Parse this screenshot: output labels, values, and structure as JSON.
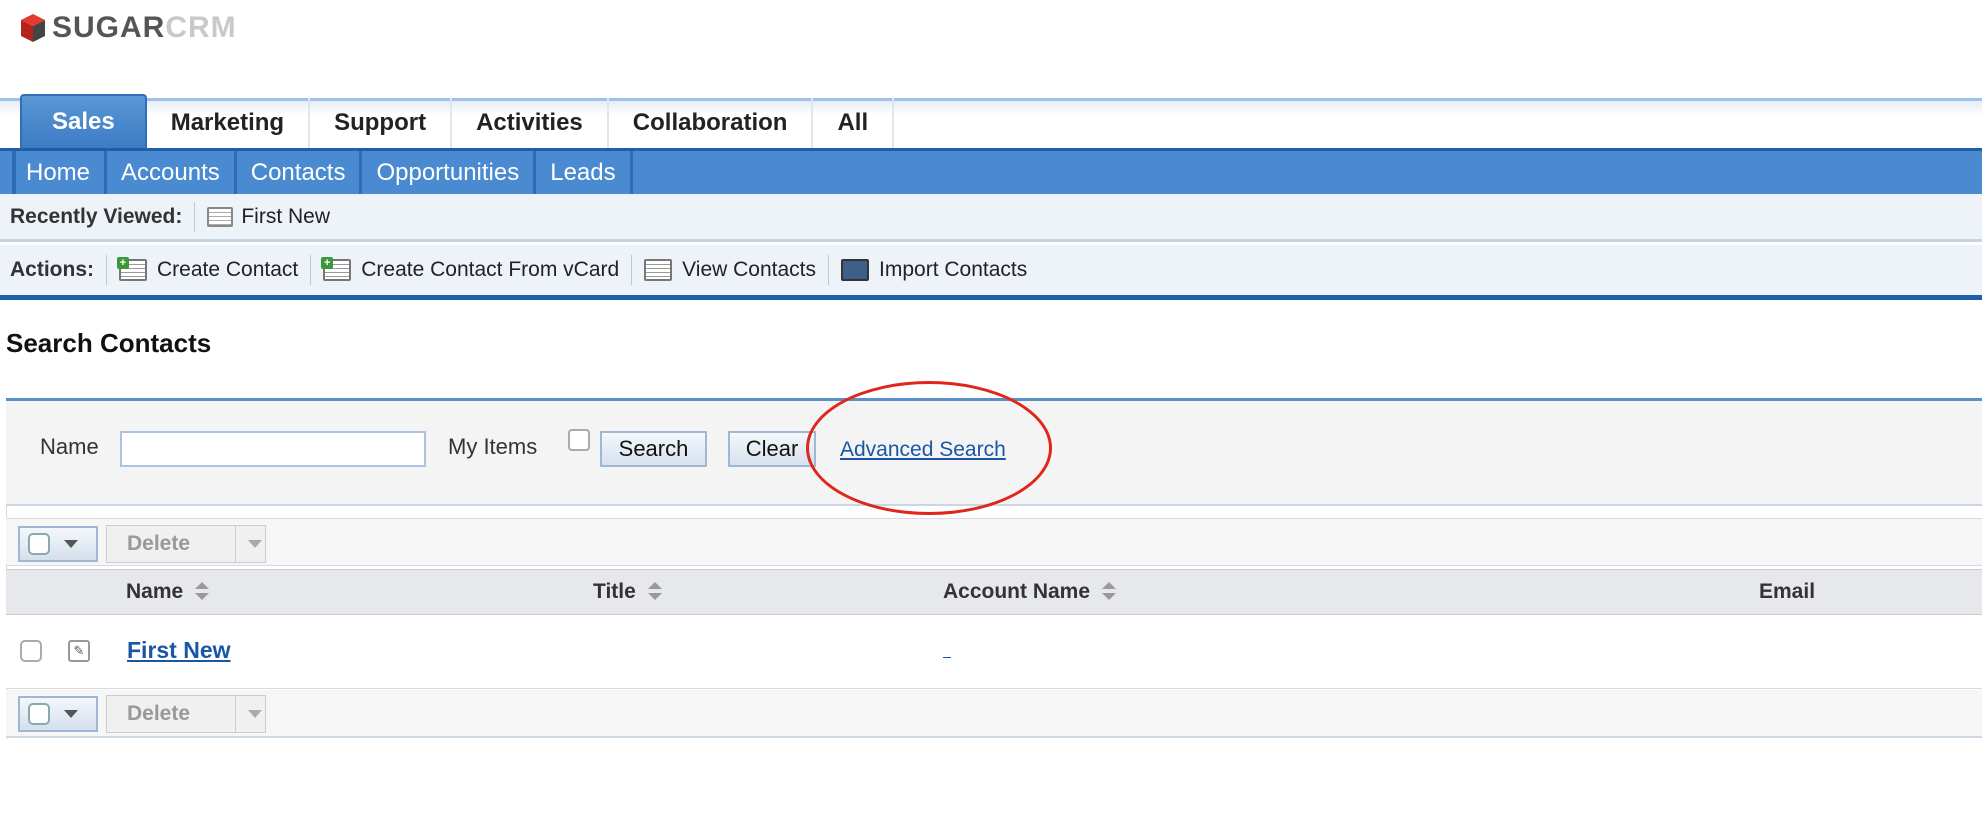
{
  "logo": {
    "brand_main": "SUGAR",
    "brand_secondary": "CRM"
  },
  "tabs": [
    {
      "label": "Sales",
      "active": true
    },
    {
      "label": "Marketing"
    },
    {
      "label": "Support"
    },
    {
      "label": "Activities"
    },
    {
      "label": "Collaboration"
    },
    {
      "label": "All"
    }
  ],
  "subnav": [
    "Home",
    "Accounts",
    "Contacts",
    "Opportunities",
    "Leads"
  ],
  "recently_viewed": {
    "label": "Recently Viewed:",
    "items": [
      "First New"
    ]
  },
  "actions": {
    "label": "Actions:",
    "items": [
      "Create Contact",
      "Create Contact From vCard",
      "View Contacts",
      "Import Contacts"
    ]
  },
  "page_title": "Search Contacts",
  "search": {
    "name_label": "Name",
    "name_value": "",
    "my_items_label": "My Items",
    "search_button": "Search",
    "clear_button": "Clear",
    "advanced_link": "Advanced Search"
  },
  "list": {
    "delete_label": "Delete",
    "columns": [
      "Name",
      "Title",
      "Account Name",
      "Email"
    ],
    "rows": [
      {
        "name": "First New",
        "title": "",
        "account": "",
        "email": ""
      }
    ]
  },
  "colors": {
    "accent": "#4a8ad0",
    "link": "#1a56a5",
    "highlight_circle": "#e0261c"
  }
}
